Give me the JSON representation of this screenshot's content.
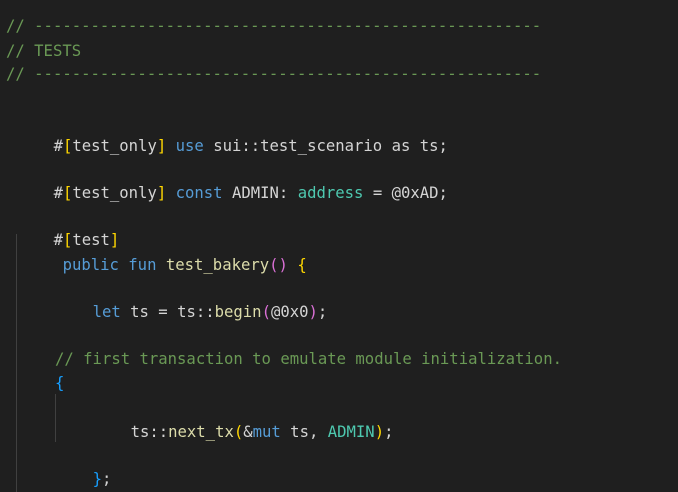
{
  "editor": {
    "lines": {
      "l1": "// ------------------------------------------------------",
      "l2": "// TESTS",
      "l3": "// ------------------------------------------------------",
      "l4": {
        "hash": "#",
        "open_b": "[",
        "attr": "test_only",
        "close_b": "]",
        "kw_use": "use",
        "path": "sui::test_scenario",
        "kw_as": "as",
        "alias": "ts;"
      },
      "l5": {
        "hash": "#",
        "open_b": "[",
        "attr": "test_only",
        "close_b": "]",
        "kw_const": "const",
        "name": "ADMIN:",
        "type": "address",
        "eq": "= @0xAD;"
      },
      "l6": {
        "hash": "#",
        "open_b": "[",
        "attr": "test",
        "close_b": "]"
      },
      "l7": {
        "kw_public": "public",
        "kw_fun": "fun",
        "fname": "test_bakery",
        "parens": "()",
        "brace": "{"
      },
      "l8": {
        "kw_let": "let",
        "var": "ts = ts::",
        "fcall": "begin",
        "open_p": "(",
        "arg": "@0x0",
        "close_p": ")",
        "semi": ";"
      },
      "l9": "// first transaction to emulate module initialization.",
      "l10": "{",
      "l11": {
        "ns": "ts::",
        "fcall": "next_tx",
        "open_p": "(",
        "amp": "&",
        "kw_mut": "mut",
        "arg1": " ts, ",
        "arg2": "ADMIN",
        "close_p": ")",
        "semi": ";"
      },
      "l12": {
        "brace": "}",
        "semi": ";"
      }
    }
  }
}
